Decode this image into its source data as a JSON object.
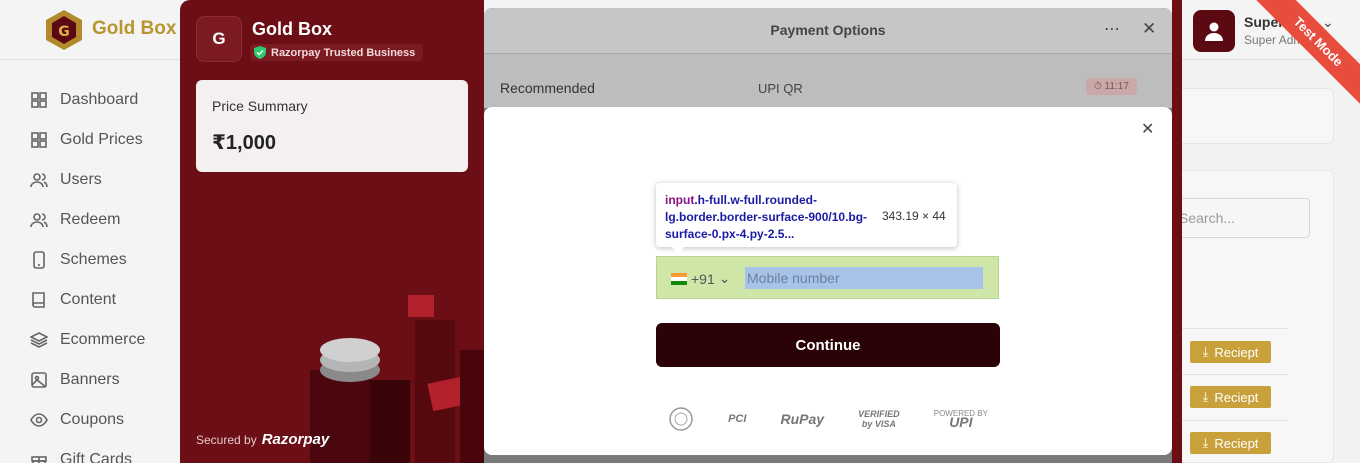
{
  "app": {
    "brand": "Gold Box",
    "user_name": "Super Va...",
    "user_role": "Super Admin",
    "test_mode": "Test Mode"
  },
  "sidebar": {
    "items": [
      {
        "label": "Dashboard",
        "icon": "grid-icon"
      },
      {
        "label": "Gold Prices",
        "icon": "grid-icon"
      },
      {
        "label": "Users",
        "icon": "users-icon"
      },
      {
        "label": "Redeem",
        "icon": "users-icon"
      },
      {
        "label": "Schemes",
        "icon": "phone-icon"
      },
      {
        "label": "Content",
        "icon": "book-icon"
      },
      {
        "label": "Ecommerce",
        "icon": "layers-icon"
      },
      {
        "label": "Banners",
        "icon": "image-icon"
      },
      {
        "label": "Coupons",
        "icon": "eye-icon"
      },
      {
        "label": "Gift Cards",
        "icon": "gift-icon"
      }
    ]
  },
  "right": {
    "search_placeholder": "Search...",
    "receipt_label": "Reciept"
  },
  "razorpay": {
    "merchant_initial": "G",
    "merchant_name": "Gold Box",
    "trusted_label": "Razorpay Trusted Business",
    "price_summary_label": "Price Summary",
    "price_value": "₹1,000",
    "secured_by": "Secured by",
    "secured_brand": "Razorpay",
    "header_title": "Payment Options",
    "recommended": "Recommended",
    "upi_qr": "UPI QR",
    "timer": "11:17"
  },
  "login": {
    "country_code": "+91",
    "mobile_placeholder": "Mobile number",
    "continue_label": "Continue",
    "tooltip_tag": "input",
    "tooltip_classes": ".h-full.w-full.rounded-lg.border.border-surface-900/10.bg-surface-0.px-4.py-2.5...",
    "tooltip_dims": "343.19 × 44",
    "logos": {
      "pci": "PCI",
      "rupay": "RuPay",
      "visa_line1": "VERIFIED",
      "visa_line2": "by VISA",
      "upi_top": "POWERED BY",
      "upi": "UPI"
    }
  }
}
